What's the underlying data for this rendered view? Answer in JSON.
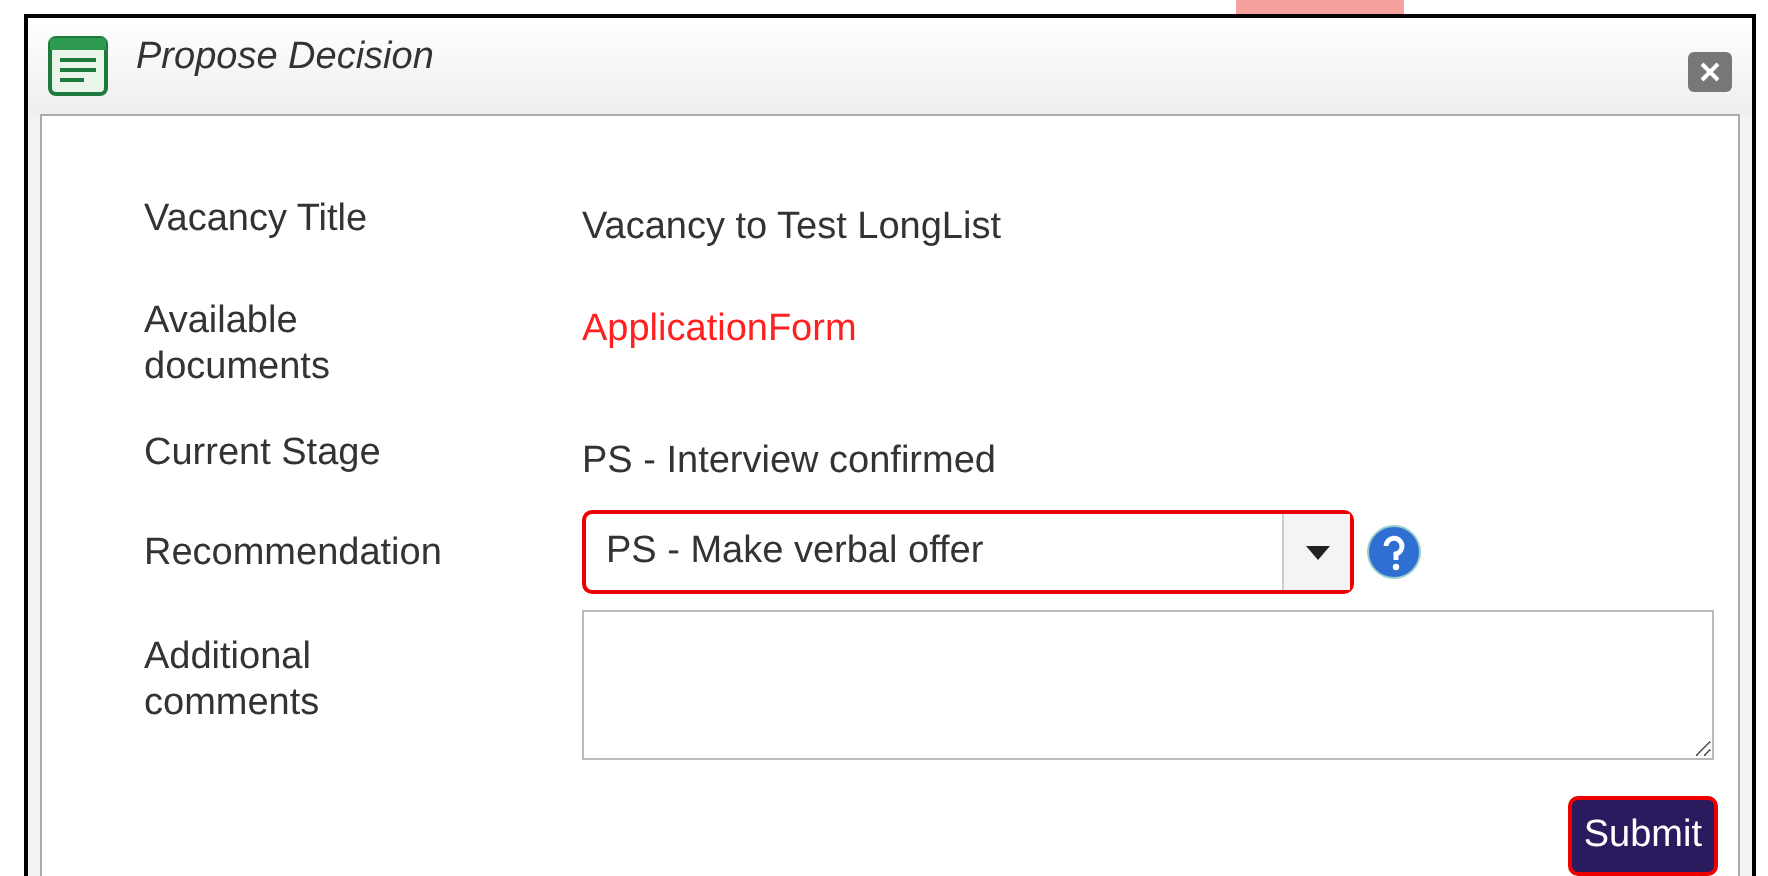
{
  "window": {
    "title": "Propose Decision"
  },
  "fields": [
    {
      "kind": "text",
      "label": "Vacancy Title",
      "value": "Vacancy to Test LongList"
    },
    {
      "kind": "link",
      "label": "Available documents",
      "value": "ApplicationForm"
    },
    {
      "kind": "text",
      "label": "Current Stage",
      "value": "PS - Interview confirmed"
    },
    {
      "kind": "select",
      "label": "Recommendation",
      "value": "PS - Make verbal offer"
    },
    {
      "kind": "textarea",
      "label": "Additional comments"
    }
  ],
  "buttons": [
    "Submit"
  ]
}
